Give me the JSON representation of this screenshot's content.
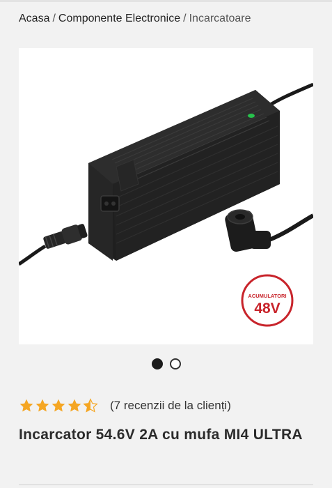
{
  "breadcrumb": {
    "home": "Acasa",
    "separator": "/",
    "category": "Componente Electronice",
    "current": "Incarcatoare"
  },
  "product_image": {
    "icon": "battery-charger-photo",
    "badge_top": "ACUMULATORI",
    "badge_main": "48V",
    "badge_color": "#c8242b"
  },
  "gallery_dots": {
    "count": 2,
    "active_index": 0
  },
  "rating": {
    "value": 4.5,
    "max": 5,
    "star_color": "#f5a623",
    "reviews_text": "(7 recenzii de la clienți)"
  },
  "product": {
    "title": "Incarcator 54.6V 2A cu mufa MI4 ULTRA"
  }
}
